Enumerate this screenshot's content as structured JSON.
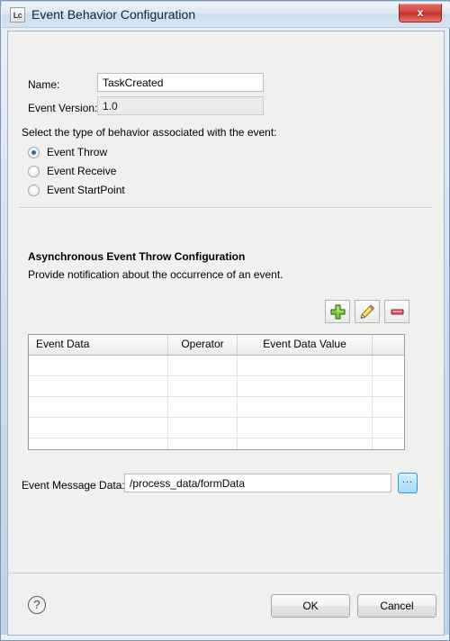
{
  "window": {
    "title": "Event Behavior Configuration",
    "app_icon_text": "Lc",
    "close_label": "x"
  },
  "form": {
    "name_label": "Name:",
    "name_value": "TaskCreated",
    "version_label": "Event Version:",
    "version_value": "1.0",
    "behavior_prompt": "Select the type of behavior associated with the event:",
    "behavior_options": [
      {
        "label": "Event Throw",
        "selected": true
      },
      {
        "label": "Event Receive",
        "selected": false
      },
      {
        "label": "Event StartPoint",
        "selected": false
      }
    ]
  },
  "section": {
    "title": "Asynchronous Event Throw Configuration",
    "subtitle": "Provide notification about the occurrence of an event."
  },
  "toolbar": {
    "add_label": "add-icon",
    "edit_label": "edit-icon",
    "remove_label": "remove-icon"
  },
  "table": {
    "columns": [
      "Event Data",
      "Operator",
      "Event Data Value",
      ""
    ],
    "rows": [
      [
        "",
        "",
        "",
        ""
      ],
      [
        "",
        "",
        "",
        ""
      ],
      [
        "",
        "",
        "",
        ""
      ],
      [
        "",
        "",
        "",
        ""
      ],
      [
        "",
        "",
        "",
        ""
      ]
    ]
  },
  "message_data": {
    "label": "Event Message Data:",
    "value": "/process_data/formData",
    "browse_label": "..."
  },
  "footer": {
    "help_label": "?",
    "ok_label": "OK",
    "cancel_label": "Cancel"
  },
  "colors": {
    "accent": "#2b6ca3",
    "close_red": "#c32e26",
    "browse_blue": "#2e9bd0",
    "add_green": "#5fae2e",
    "remove_red": "#d33a4a"
  }
}
